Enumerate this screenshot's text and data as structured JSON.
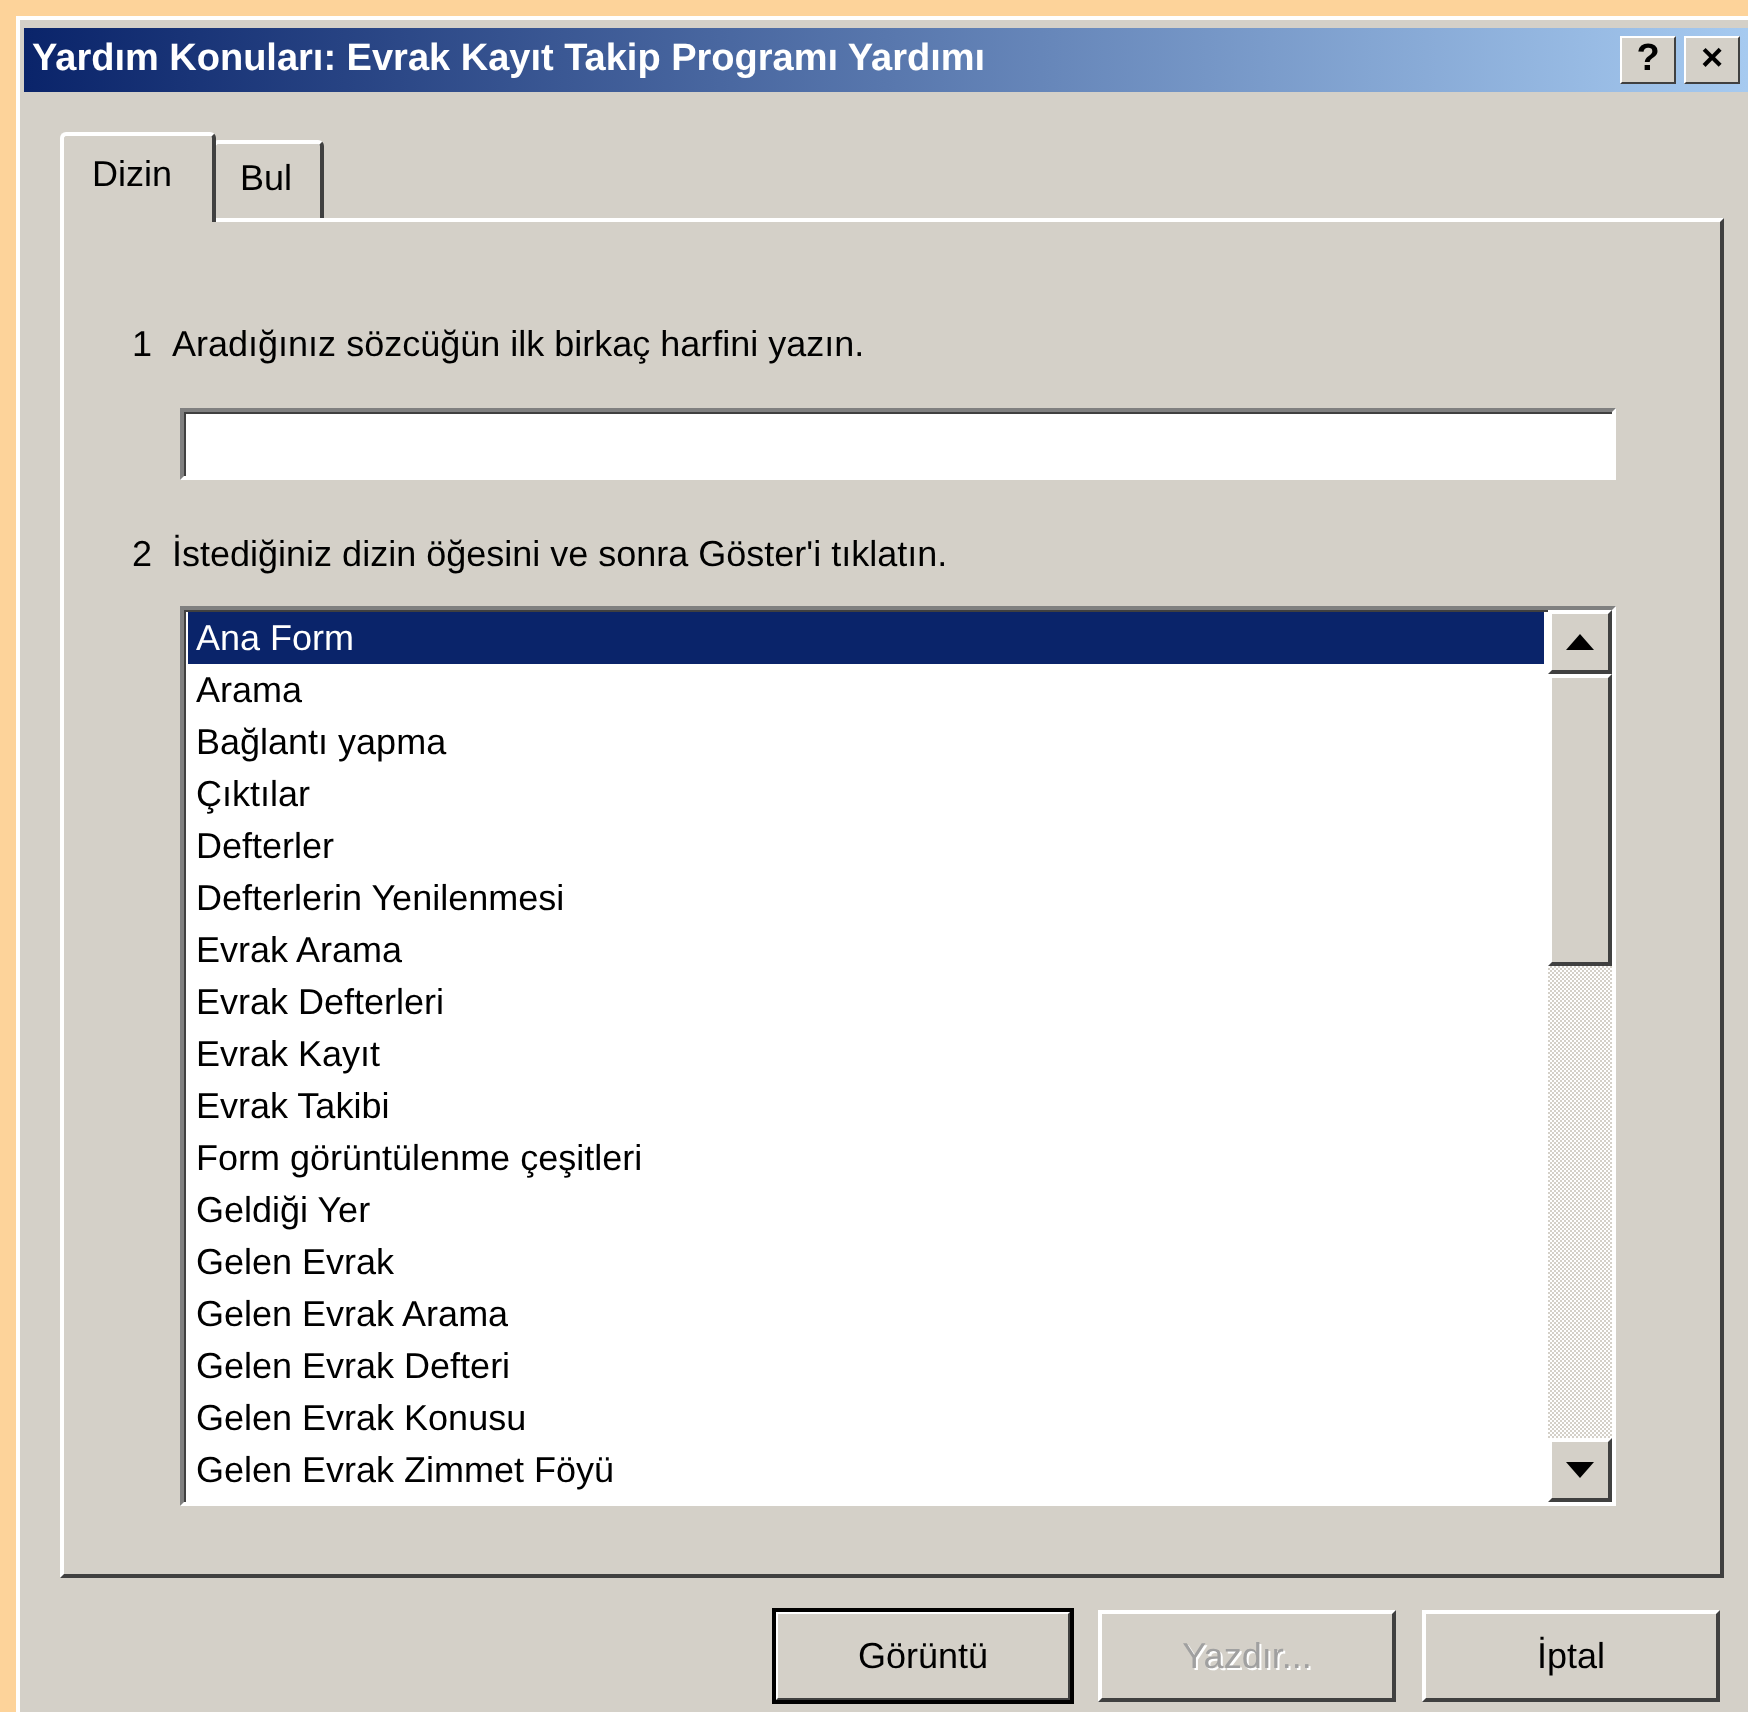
{
  "window": {
    "title": "Yardım Konuları: Evrak Kayıt Takip Programı Yardımı",
    "title_buttons": [
      "?",
      "×"
    ]
  },
  "tabs": [
    {
      "label": "Dizin",
      "selected": true
    },
    {
      "label": "Bul",
      "selected": false
    }
  ],
  "step_1": {
    "number": "1",
    "text": "Aradığınız sözcüğün ilk birkaç harfini yazın."
  },
  "step_2": {
    "number": "2",
    "text": "İstediğiniz dizin öğesini ve sonra Göster'i tıklatın."
  },
  "index_list": [
    {
      "label": "Ana Form",
      "selected": true
    },
    {
      "label": "Arama",
      "selected": false
    },
    {
      "label": "Bağlantı yapma",
      "selected": false
    },
    {
      "label": "Çıktılar",
      "selected": false
    },
    {
      "label": "Defterler",
      "selected": false
    },
    {
      "label": "Defterlerin Yenilenmesi",
      "selected": false
    },
    {
      "label": "Evrak Arama",
      "selected": false
    },
    {
      "label": "Evrak Defterleri",
      "selected": false
    },
    {
      "label": "Evrak Kayıt",
      "selected": false
    },
    {
      "label": "Evrak Takibi",
      "selected": false
    },
    {
      "label": "Form görüntülenme çeşitleri",
      "selected": false
    },
    {
      "label": "Geldiği Yer",
      "selected": false
    },
    {
      "label": "Gelen Evrak",
      "selected": false
    },
    {
      "label": "Gelen Evrak Arama",
      "selected": false
    },
    {
      "label": "Gelen Evrak Defteri",
      "selected": false
    },
    {
      "label": "Gelen Evrak Konusu",
      "selected": false
    },
    {
      "label": "Gelen Evrak Zimmet Föyü",
      "selected": false
    }
  ],
  "buttons": [
    {
      "label": "Görüntü",
      "disabled": false,
      "default": true
    },
    {
      "label": "Yazdır...",
      "disabled": true,
      "default": false
    },
    {
      "label": "İptal",
      "disabled": false,
      "default": false
    }
  ]
}
